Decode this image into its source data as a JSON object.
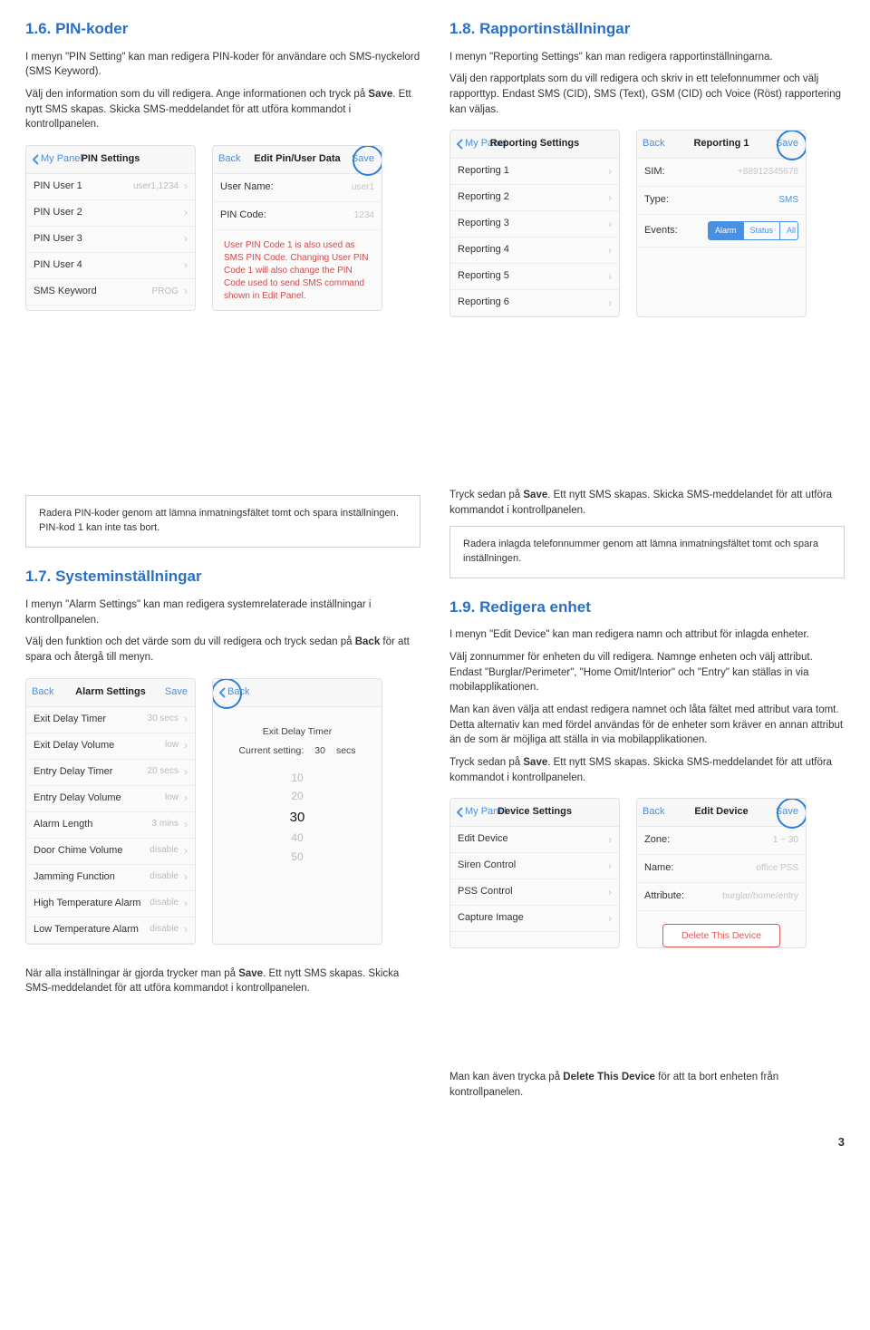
{
  "s16": {
    "title": "1.6. PIN-koder",
    "p1_a": "I menyn \"PIN Setting\" kan man redigera PIN-koder för användare och SMS-nyckelord (SMS Keyword).",
    "p2_a": "Välj den information som du vill redigera. Ange informationen och tryck på ",
    "p2_b": "Save",
    "p2_c": ". Ett nytt SMS skapas. Skicka SMS-meddelandet för att utföra kommandot i kontrollpanelen."
  },
  "pin_list": {
    "back": "My Panel",
    "title": "PIN Settings",
    "rows": [
      {
        "l": "PIN User 1",
        "v": "user1,1234"
      },
      {
        "l": "PIN User 2",
        "v": ""
      },
      {
        "l": "PIN User 3",
        "v": ""
      },
      {
        "l": "PIN User 4",
        "v": ""
      },
      {
        "l": "SMS Keyword",
        "v": "PROG"
      }
    ]
  },
  "pin_edit": {
    "back": "Back",
    "title": "Edit Pin/User Data",
    "save": "Save",
    "rows": [
      {
        "l": "User Name:",
        "v": "user1"
      },
      {
        "l": "PIN Code:",
        "v": "1234"
      }
    ],
    "note": "User PIN Code 1 is also used as SMS PIN Code. Changing User PIN Code 1 will also change the PIN Code used to send SMS command shown in Edit Panel."
  },
  "s18": {
    "title": "1.8. Rapportinställningar",
    "p1": "I menyn \"Reporting Settings\" kan man redigera rapportinställningarna.",
    "p2": "Välj den rapportplats som du vill redigera och skriv in ett telefonnummer och välj rapporttyp. Endast SMS (CID), SMS (Text), GSM (CID) och Voice (Röst) rapportering kan väljas."
  },
  "rep_list": {
    "back": "My Panel",
    "title": "Reporting Settings",
    "rows": [
      {
        "l": "Reporting 1"
      },
      {
        "l": "Reporting 2"
      },
      {
        "l": "Reporting 3"
      },
      {
        "l": "Reporting 4"
      },
      {
        "l": "Reporting 5"
      },
      {
        "l": "Reporting 6"
      }
    ]
  },
  "rep_edit": {
    "back": "Back",
    "title": "Reporting 1",
    "save": "Save",
    "sim": {
      "l": "SIM:",
      "v": "+88912345678"
    },
    "type": {
      "l": "Type:",
      "v": "SMS"
    },
    "events": {
      "l": "Events:",
      "opts": [
        "Alarm",
        "Status",
        "All"
      ]
    }
  },
  "note1": "Radera PIN-koder genom att lämna inmatningsfältet tomt och spara inställningen. PIN-kod 1 kan inte tas bort.",
  "s17": {
    "title": "1.7. Systeminställningar",
    "p1": "I menyn \"Alarm Settings\" kan man redigera systemrelaterade inställningar i kontrollpanelen.",
    "p2_a": "Välj den funktion och det värde som du vill redigera och tryck sedan på ",
    "p2_b": "Back",
    "p2_c": " för att spara och återgå till menyn."
  },
  "alarm_list": {
    "back": "Back",
    "title": "Alarm Settings",
    "save": "Save",
    "rows": [
      {
        "l": "Exit Delay Timer",
        "v": "30 secs"
      },
      {
        "l": "Exit Delay Volume",
        "v": "low"
      },
      {
        "l": "Entry Delay Timer",
        "v": "20 secs"
      },
      {
        "l": "Entry Delay Volume",
        "v": "low"
      },
      {
        "l": "Alarm Length",
        "v": "3 mins"
      },
      {
        "l": "Door Chime Volume",
        "v": "disable"
      },
      {
        "l": "Jamming Function",
        "v": "disable"
      },
      {
        "l": "High Temperature Alarm",
        "v": "disable"
      },
      {
        "l": "Low Temperature Alarm",
        "v": "disable"
      }
    ]
  },
  "alarm_timer": {
    "back": "Back",
    "title": "Exit Delay Timer",
    "cur": "Current setting:",
    "val": "30",
    "unit": "secs",
    "picker": [
      "10",
      "20",
      "30",
      "40",
      "50"
    ]
  },
  "p_after_alarm_a": "När alla inställningar är gjorda trycker man på ",
  "p_after_alarm_b": "Save",
  "p_after_alarm_c": ". Ett nytt SMS skapas. Skicka SMS-meddelandet för att utföra kommandot i kontrollpanelen.",
  "p_save_right_a": "Tryck sedan på ",
  "p_save_right_b": "Save",
  "p_save_right_c": ". Ett nytt SMS skapas. Skicka SMS-meddelandet för att utföra kommandot i kontrollpanelen.",
  "note2": "Radera inlagda telefonnummer genom att lämna inmatningsfältet tomt och spara inställningen.",
  "s19": {
    "title": "1.9. Redigera enhet",
    "p1": "I menyn \"Edit Device\" kan man redigera namn och attribut för inlagda enheter.",
    "p2": "Välj zonnummer för enheten du vill redigera. Namnge enheten och välj attribut. Endast \"Burglar/Perimeter\", \"Home Omit/Interior\" och \"Entry\" kan ställas in via mobilapplikationen.",
    "p3": "Man kan även välja att endast redigera namnet och låta fältet med attribut vara tomt. Detta alternativ kan med fördel användas för de enheter som kräver en annan attribut än de som är möjliga att ställa in via mobilapplikationen.",
    "p4_a": "Tryck sedan på ",
    "p4_b": "Save",
    "p4_c": ". Ett nytt SMS skapas. Skicka SMS-meddelandet för att utföra kommandot i kontrollpanelen."
  },
  "dev_list": {
    "back": "My Panel",
    "title": "Device Settings",
    "rows": [
      {
        "l": "Edit Device"
      },
      {
        "l": "Siren Control"
      },
      {
        "l": "PSS Control"
      },
      {
        "l": "Capture Image"
      }
    ]
  },
  "dev_edit": {
    "back": "Back",
    "title": "Edit Device",
    "save": "Save",
    "rows": [
      {
        "l": "Zone:",
        "v": "1 ~ 30"
      },
      {
        "l": "Name:",
        "v": "office PSS"
      },
      {
        "l": "Attribute:",
        "v": "burglar/home/entry"
      }
    ],
    "del": "Delete This Device"
  },
  "p_delete_a": "Man kan även trycka på ",
  "p_delete_b": "Delete This Device",
  "p_delete_c": " för att ta bort enheten från kontrollpanelen.",
  "page_num": "3"
}
